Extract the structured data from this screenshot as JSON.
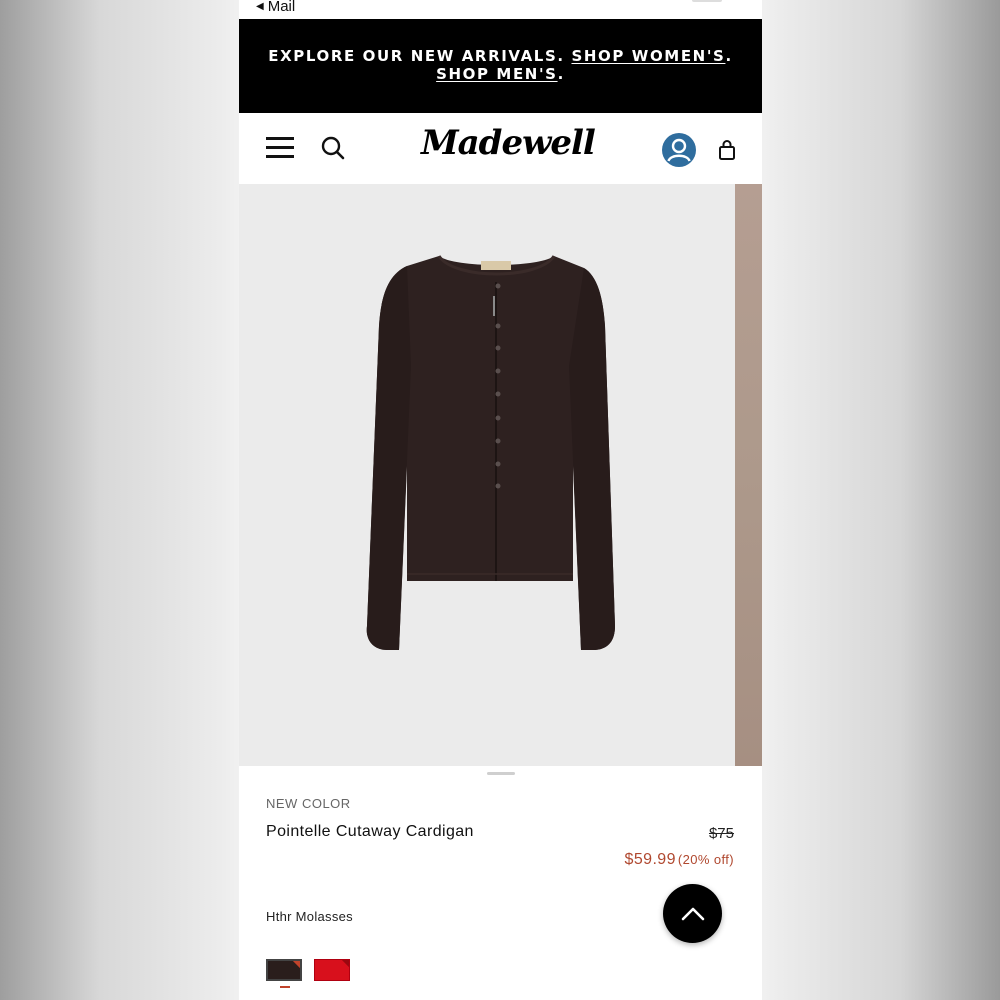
{
  "status_bar": {
    "back_label": "Mail"
  },
  "promo": {
    "lead_text": "EXPLORE OUR NEW ARRIVALS.",
    "link_women": "SHOP WOMEN'S",
    "link_men": "SHOP MEN'S",
    "period": "."
  },
  "header": {
    "logo_text": "Madewell",
    "icons": [
      "menu-icon",
      "search-icon",
      "account-icon",
      "bag-icon"
    ]
  },
  "product": {
    "badge": "NEW COLOR",
    "name": "Pointelle Cutaway Cardigan",
    "original_price": "$75",
    "sale_price": "$59.99",
    "discount": "(20% off)",
    "color_name": "Hthr Molasses",
    "swatches": [
      {
        "name": "Hthr Molasses",
        "color": "#2a1e1c",
        "selected": true
      },
      {
        "name": "Red",
        "color": "#d8101c",
        "selected": false
      }
    ]
  },
  "colors": {
    "banner_bg": "#000000",
    "sale_accent": "#b0482f",
    "account_blue": "#2f6d9e",
    "product_bg": "#ebebeb"
  }
}
